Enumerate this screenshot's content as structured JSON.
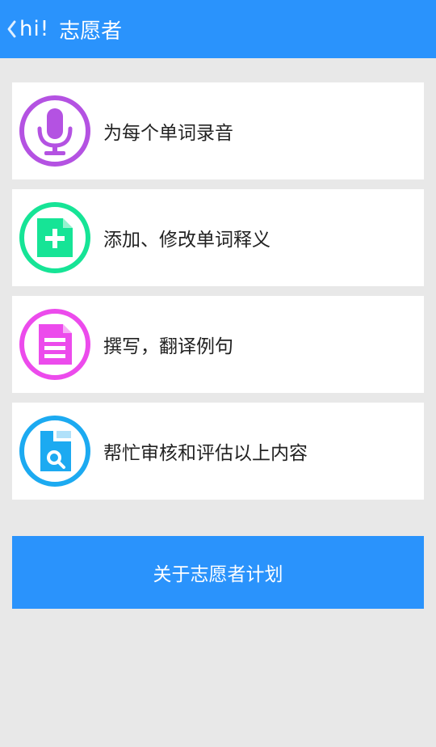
{
  "header": {
    "back_text": "hi!",
    "title": "志愿者"
  },
  "items": [
    {
      "label": "为每个单词录音",
      "icon": "microphone-icon",
      "color": "#b452e2"
    },
    {
      "label": "添加、修改单词释义",
      "icon": "add-document-icon",
      "color": "#16e496"
    },
    {
      "label": "撰写，翻译例句",
      "icon": "document-icon",
      "color": "#ec4bec"
    },
    {
      "label": "帮忙审核和评估以上内容",
      "icon": "search-document-icon",
      "color": "#1caaf1"
    }
  ],
  "about_button": {
    "label": "关于志愿者计划"
  },
  "colors": {
    "primary": "#2a93fc",
    "background": "#e8e8e8"
  }
}
